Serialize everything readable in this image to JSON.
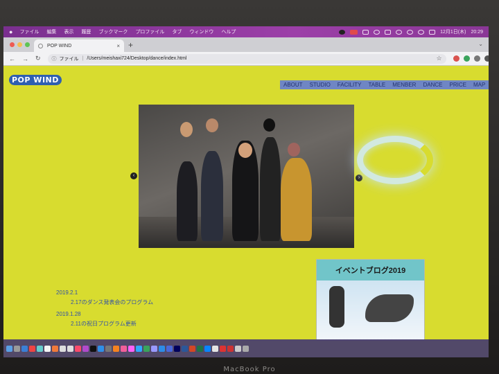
{
  "device": {
    "label": "MacBook Pro"
  },
  "menubar": {
    "items": [
      "ファイル",
      "編集",
      "表示",
      "履歴",
      "ブックマーク",
      "プロファイル",
      "タブ",
      "ウィンドウ",
      "ヘルプ"
    ],
    "date": "12月1日(木)",
    "time": "20:29"
  },
  "browser": {
    "tab_title": "POP WIND",
    "new_tab": "+",
    "close_tab": "×",
    "address_prefix": "ファイル",
    "address": "/Users/meishaxi724/Desktop/dance/index.html",
    "avatar_letter": "m"
  },
  "site": {
    "logo": "POP WIND",
    "nav": [
      "ABOUT",
      "STUDIO",
      "FACILITY",
      "TABLE",
      "MENBER",
      "DANCE",
      "PRICE",
      "MAP"
    ],
    "slider_prev": "‹",
    "slider_next": "›",
    "news": [
      {
        "date": "2019.2.1",
        "text": "2.17のダンス発表会のプログラム"
      },
      {
        "date": "2019.1.28",
        "text": "2.11の祝日プログラム更新"
      }
    ],
    "blog_banner": "イベントブログ2019"
  },
  "colors": {
    "page_background": "#d8dc2f",
    "nav_background": "#6f86c4",
    "link_color": "#3050a8",
    "menubar": "#9c3fa8",
    "blog_header": "#71c5c9"
  }
}
